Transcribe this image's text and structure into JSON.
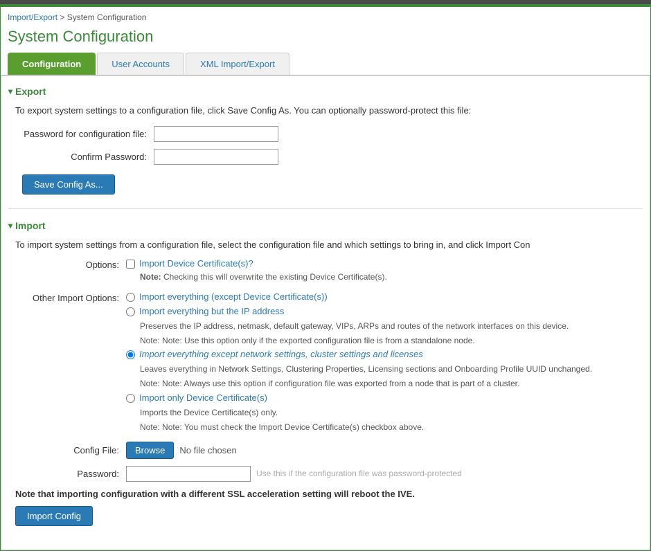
{
  "topbar": {
    "color": "#4a7a4a"
  },
  "breadcrumb": {
    "link_text": "Import/Export",
    "separator": " > ",
    "current": "System Configuration"
  },
  "page_title": "System Configuration",
  "tabs": [
    {
      "id": "configuration",
      "label": "Configuration",
      "active": true
    },
    {
      "id": "user-accounts",
      "label": "User Accounts",
      "active": false
    },
    {
      "id": "xml-import-export",
      "label": "XML Import/Export",
      "active": false
    }
  ],
  "export": {
    "section_label": "Export",
    "description": "To export system settings to a configuration file, click Save Config As. You can optionally password-protect this file:",
    "password_label": "Password for configuration file:",
    "confirm_label": "Confirm Password:",
    "save_button": "Save Config As..."
  },
  "import": {
    "section_label": "Import",
    "description": "To import system settings from a configuration file, select the configuration file and which settings to bring in, and click Import Con",
    "options_label": "Options:",
    "import_device_cert_checkbox_label": "Import Device Certificate(s)?",
    "import_device_cert_note": "Checking this will overwrite the existing Device Certificate(s).",
    "other_import_label": "Other Import Options:",
    "radio_options": [
      {
        "id": "opt1",
        "label": "Import everything (except Device Certificate(s))",
        "checked": false,
        "notes": []
      },
      {
        "id": "opt2",
        "label": "Import everything but the IP address",
        "checked": false,
        "notes": [
          "Preserves the IP address, netmask, default gateway, VIPs, ARPs and routes of the network interfaces on this device.",
          "Note: Use this option only if the exported configuration file is from a standalone node."
        ]
      },
      {
        "id": "opt3",
        "label": "Import everything except network settings, cluster settings and licenses",
        "checked": true,
        "notes": [
          "Leaves everything in Network Settings, Clustering Properties, Licensing sections and Onboarding Profile UUID unchanged.",
          "Note: Always use this option if configuration file was exported from a node that is part of a cluster."
        ]
      },
      {
        "id": "opt4",
        "label": "Import only Device Certificate(s)",
        "checked": false,
        "notes": [
          "Imports the Device Certificate(s) only.",
          "Note: You must check the Import Device Certificate(s) checkbox above."
        ]
      }
    ],
    "config_file_label": "Config File:",
    "browse_button": "Browse",
    "no_file_text": "No file chosen",
    "password_label": "Password:",
    "password_placeholder": "Use this if the configuration file was password-protected",
    "warning_note": "Note that importing configuration with a different SSL acceleration setting will reboot the IVE.",
    "import_button": "Import Config"
  }
}
